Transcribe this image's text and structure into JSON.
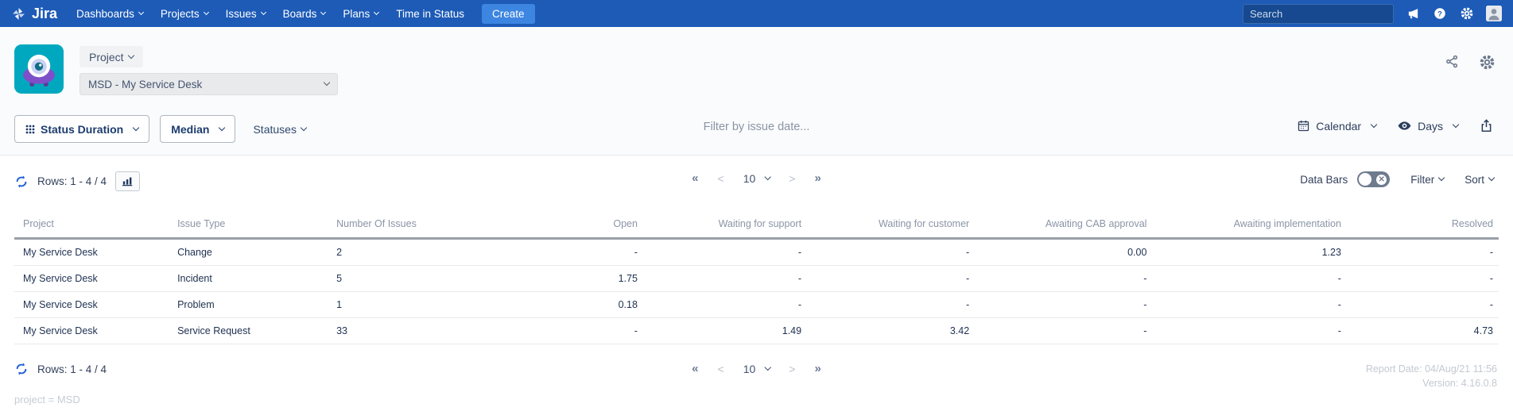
{
  "nav": {
    "brand": "Jira",
    "items": [
      {
        "label": "Dashboards"
      },
      {
        "label": "Projects"
      },
      {
        "label": "Issues"
      },
      {
        "label": "Boards"
      },
      {
        "label": "Plans"
      },
      {
        "label": "Time in Status"
      }
    ],
    "create_label": "Create",
    "search_placeholder": "Search"
  },
  "header": {
    "scope_label": "Project",
    "project_value": "MSD - My Service Desk"
  },
  "toolbar": {
    "metric_label": "Status Duration",
    "calc_label": "Median",
    "statuses_label": "Statuses",
    "date_filter_placeholder": "Filter by issue date...",
    "calendar_label": "Calendar",
    "unit_label": "Days"
  },
  "controls": {
    "rows_summary": "Rows: 1 - 4 / 4",
    "data_bars_label": "Data Bars",
    "filter_label": "Filter",
    "sort_label": "Sort"
  },
  "pagination": {
    "first": "«",
    "prev": "<",
    "size": "10",
    "next": ">",
    "last": "»"
  },
  "table": {
    "columns": [
      "Project",
      "Issue Type",
      "Number Of Issues",
      "Open",
      "Waiting for support",
      "Waiting for customer",
      "Awaiting CAB approval",
      "Awaiting implementation",
      "Resolved"
    ],
    "rows": [
      [
        "My Service Desk",
        "Change",
        "2",
        "-",
        "-",
        "-",
        "0.00",
        "1.23",
        "-"
      ],
      [
        "My Service Desk",
        "Incident",
        "5",
        "1.75",
        "-",
        "-",
        "-",
        "-",
        "-"
      ],
      [
        "My Service Desk",
        "Problem",
        "1",
        "0.18",
        "-",
        "-",
        "-",
        "-",
        "-"
      ],
      [
        "My Service Desk",
        "Service Request",
        "33",
        "-",
        "1.49",
        "3.42",
        "-",
        "-",
        "4.73"
      ]
    ]
  },
  "footer": {
    "report_date": "Report Date: 04/Aug/21 11:56",
    "version": "Version: 4.16.0.8",
    "query": "project = MSD"
  },
  "colors": {
    "nav_bg": "#1d5bb7",
    "create_bg": "#3c85e0",
    "avatar_teal": "#00a8bf",
    "avatar_purple": "#7e4fc9",
    "accent_navy": "#1c3c6e",
    "refresh_blue": "#1f5fd6"
  }
}
